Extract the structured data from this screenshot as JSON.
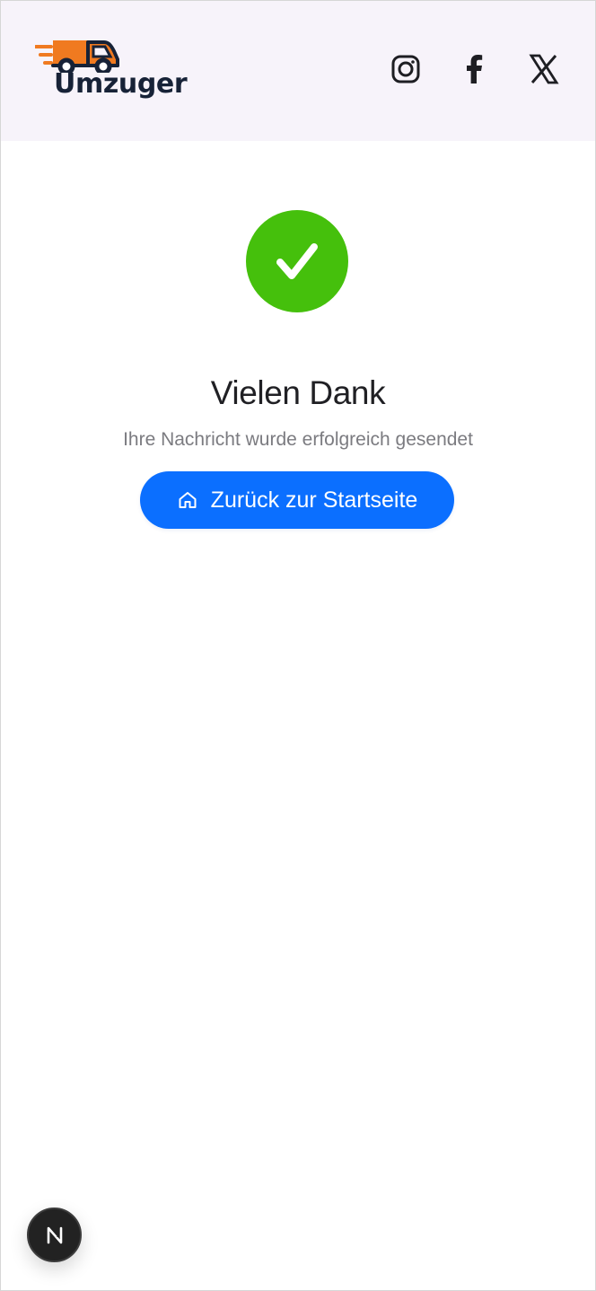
{
  "header": {
    "brand": {
      "name": "Umzuger",
      "icon": "moving-truck-icon",
      "text_color": "#172237",
      "truck_color": "#f07a20"
    },
    "social": [
      {
        "name": "Instagram",
        "icon": "instagram-icon"
      },
      {
        "name": "Facebook",
        "icon": "facebook-icon"
      },
      {
        "name": "X",
        "icon": "x-icon"
      }
    ],
    "background": "#f7f3fa"
  },
  "confirmation": {
    "status_icon": "check-icon",
    "status_color": "#45c00c",
    "title": "Vielen Dank",
    "message": "Ihre Nachricht wurde erfolgreich gesendet",
    "button": {
      "label": "Zurück zur Startseite",
      "icon": "home-icon",
      "color": "#0b6fff"
    }
  },
  "dev_indicator": {
    "label": "N",
    "icon": "nextjs-icon"
  }
}
